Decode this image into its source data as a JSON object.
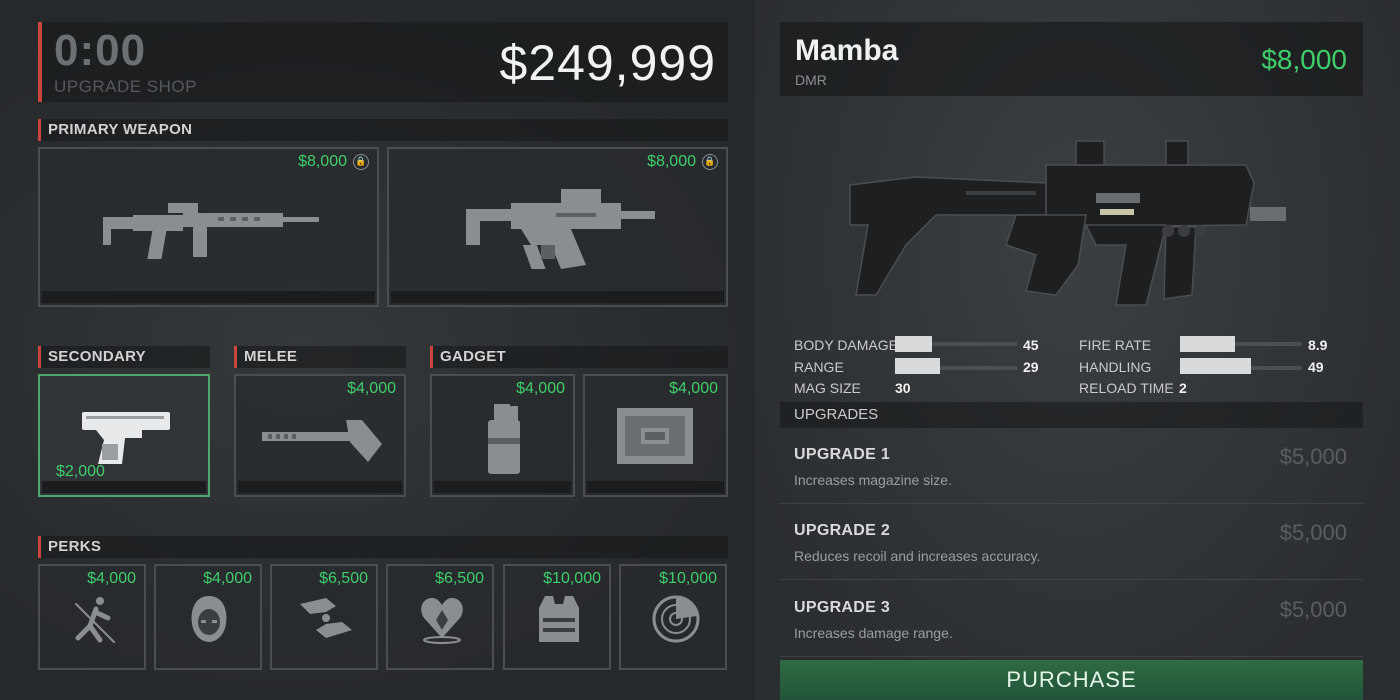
{
  "header": {
    "timer": "0:00",
    "shop_label": "UPGRADE SHOP",
    "money": "$249,999"
  },
  "sections": {
    "primary": "PRIMARY WEAPON",
    "secondary": "SECONDARY",
    "melee": "MELEE",
    "gadget": "GADGET",
    "perks": "PERKS"
  },
  "primary_weapons": [
    {
      "price": "$8,000",
      "icon": "assault-rifle-icon",
      "locked": true
    },
    {
      "price": "$8,000",
      "icon": "bullpup-rifle-icon",
      "locked": true
    }
  ],
  "secondary": {
    "price": "$2,000",
    "icon": "pistol-icon"
  },
  "melee": {
    "price": "$4,000",
    "icon": "axe-icon"
  },
  "gadgets": [
    {
      "price": "$4,000",
      "icon": "grenade-icon"
    },
    {
      "price": "$4,000",
      "icon": "crate-icon"
    }
  ],
  "perks": [
    {
      "price": "$4,000",
      "icon": "sprint-icon"
    },
    {
      "price": "$4,000",
      "icon": "hood-icon"
    },
    {
      "price": "$6,500",
      "icon": "hands-icon"
    },
    {
      "price": "$6,500",
      "icon": "heart-icon"
    },
    {
      "price": "$10,000",
      "icon": "vest-icon"
    },
    {
      "price": "$10,000",
      "icon": "radar-icon"
    }
  ],
  "detail": {
    "name": "Mamba",
    "type": "DMR",
    "price": "$8,000",
    "image_icon": "mamba-dmr-icon",
    "stats": {
      "body_damage": {
        "label": "BODY DAMAGE",
        "value": "45",
        "fill": 0.3
      },
      "range": {
        "label": "RANGE",
        "value": "29",
        "fill": 0.37
      },
      "mag_size": {
        "label": "MAG SIZE",
        "value": "30"
      },
      "fire_rate": {
        "label": "FIRE RATE",
        "value": "8.9",
        "fill": 0.45
      },
      "handling": {
        "label": "HANDLING",
        "value": "49",
        "fill": 0.58
      },
      "reload_time": {
        "label": "RELOAD TIME",
        "value": "2"
      }
    },
    "upgrades_heading": "UPGRADES",
    "upgrades": [
      {
        "title": "UPGRADE 1",
        "desc": "Increases magazine size.",
        "price": "$5,000"
      },
      {
        "title": "UPGRADE 2",
        "desc": "Reduces recoil and increases accuracy.",
        "price": "$5,000"
      },
      {
        "title": "UPGRADE 3",
        "desc": "Increases damage range.",
        "price": "$5,000"
      }
    ],
    "purchase_label": "PURCHASE"
  },
  "colors": {
    "accent_red": "#c9463e",
    "price_green": "#3fce6a",
    "selected_border": "#4fa86a"
  }
}
